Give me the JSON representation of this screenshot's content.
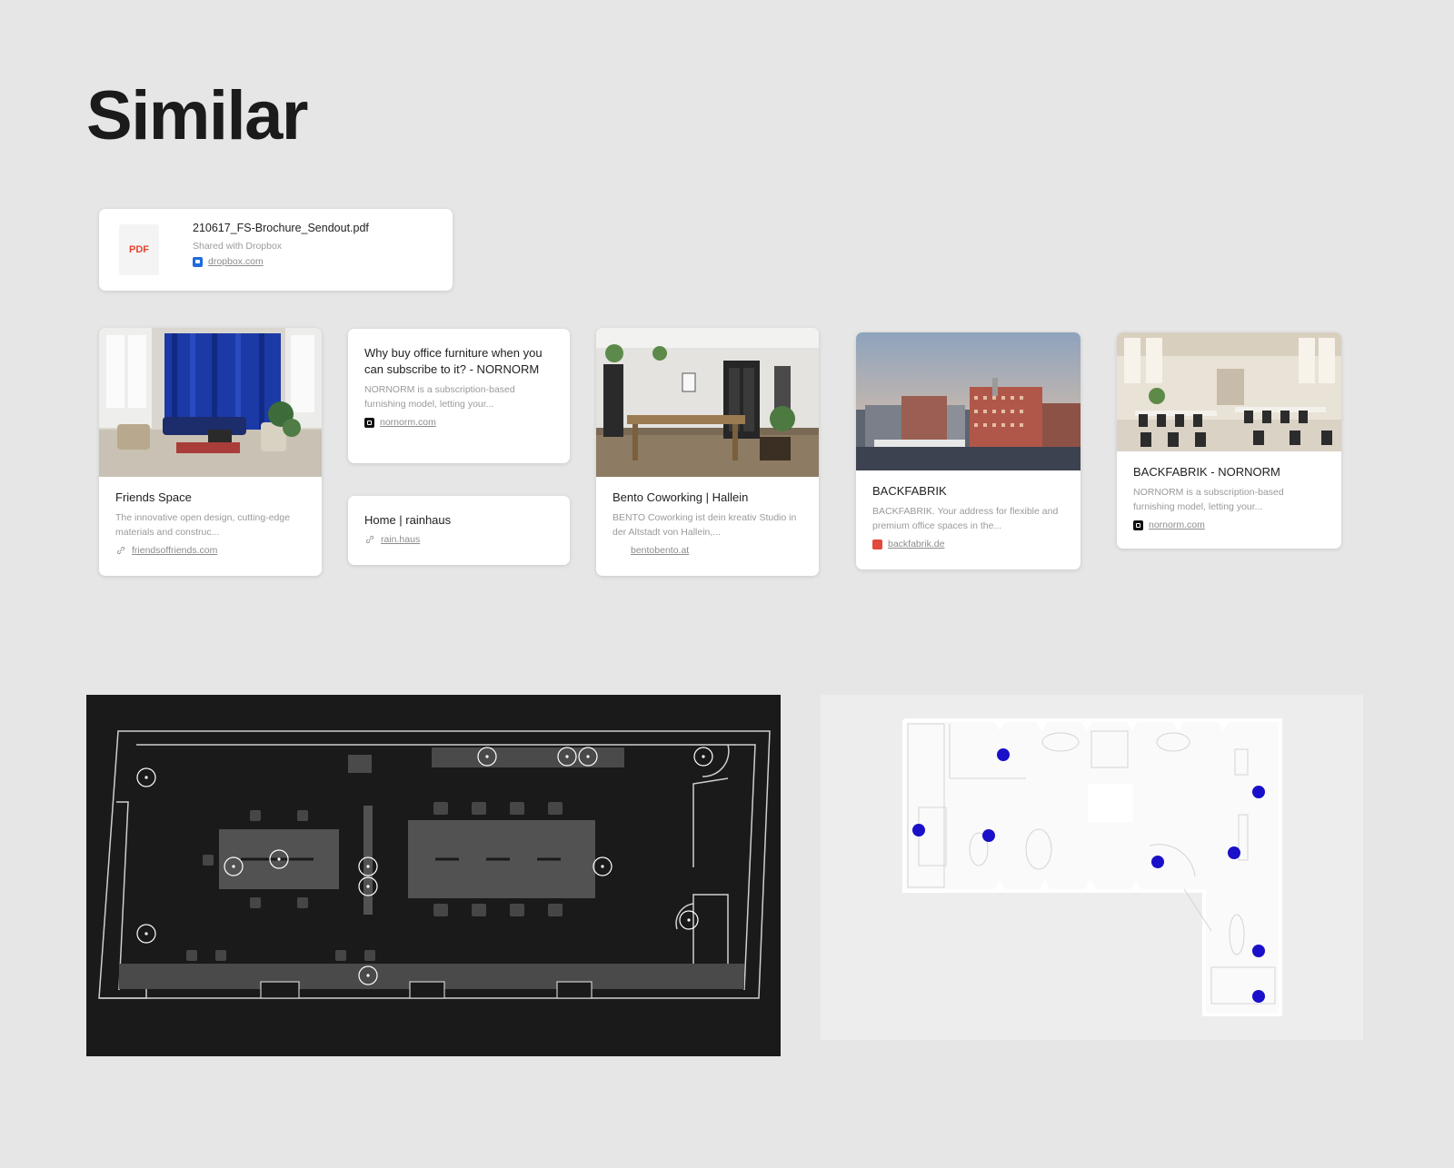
{
  "page": {
    "heading": "Similar"
  },
  "pdf_card": {
    "thumb_label": "PDF",
    "file_name": "210617_FS-Brochure_Sendout.pdf",
    "subtitle": "Shared with Dropbox",
    "link": "dropbox.com",
    "favicon": "dropbox-icon"
  },
  "cards": [
    {
      "title": "Friends Space",
      "description": "The innovative open design, cutting-edge materials and construc...",
      "link": "friendsoffriends.com",
      "favicon": "link-icon"
    },
    {
      "title": "Why buy office furniture when you can subscribe to it? - NORNORM",
      "description": "NORNORM is a subscription-based furnishing model, letting your...",
      "link": "nornorm.com",
      "favicon": "nornorm-icon"
    },
    {
      "title": "Home | rainhaus",
      "link": "rain.haus",
      "favicon": "link-icon"
    },
    {
      "title": "Bento Coworking | Hallein",
      "description": "BENTO Coworking ist dein kreativ Studio in der Altstadt von Hallein,...",
      "link": "bentobento.at"
    },
    {
      "title": "BACKFABRIK",
      "description": "BACKFABRIK. Your address for flexible and premium office spaces in the...",
      "link": "backfabrik.de",
      "favicon": "backfabrik-icon"
    },
    {
      "title": "BACKFABRIK - NORNORM",
      "description": "NORNORM is a subscription-based furnishing model, letting your...",
      "link": "nornorm.com",
      "favicon": "nornorm-icon"
    }
  ],
  "colors": {
    "background": "#e6e6e6",
    "card": "#ffffff",
    "pdf_label": "#e8422f",
    "plan_dark": "#1a1a1a",
    "plan_light": "#ededed",
    "marker_blue": "#1a10c9"
  }
}
